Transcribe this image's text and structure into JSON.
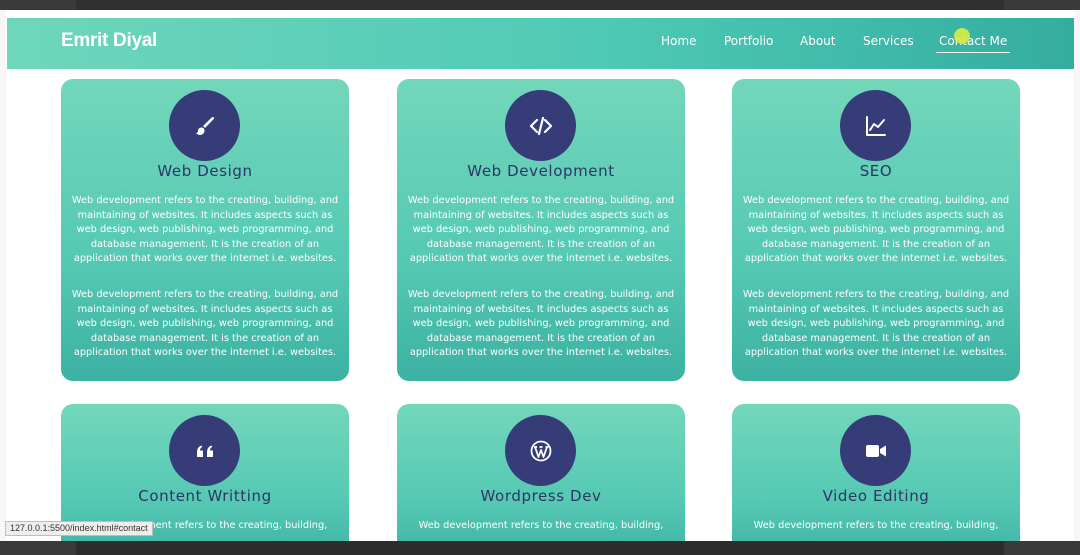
{
  "nav": {
    "brand": "Emrit Diyal",
    "links": [
      "Home",
      "Portfolio",
      "About",
      "Services",
      "Contact Me"
    ]
  },
  "cards": [
    {
      "title": "Web Design",
      "icon": "paintbrush-icon",
      "paragraphs": [
        "Web development refers to the creating, building, and maintaining of websites. It includes aspects such as web design, web publishing, web programming, and database management. It is the creation of an application that works over the internet i.e. websites.",
        "Web development refers to the creating, building, and maintaining of websites. It includes aspects such as web design, web publishing, web programming, and database management. It is the creation of an application that works over the internet i.e. websites."
      ]
    },
    {
      "title": "Web Development",
      "icon": "code-icon",
      "paragraphs": [
        "Web development refers to the creating, building, and maintaining of websites. It includes aspects such as web design, web publishing, web programming, and database management. It is the creation of an application that works over the internet i.e. websites.",
        "Web development refers to the creating, building, and maintaining of websites. It includes aspects such as web design, web publishing, web programming, and database management. It is the creation of an application that works over the internet i.e. websites."
      ]
    },
    {
      "title": "SEO",
      "icon": "line-chart-icon",
      "paragraphs": [
        "Web development refers to the creating, building, and maintaining of websites. It includes aspects such as web design, web publishing, web programming, and database management. It is the creation of an application that works over the internet i.e. websites.",
        "Web development refers to the creating, building, and maintaining of websites. It includes aspects such as web design, web publishing, web programming, and database management. It is the creation of an application that works over the internet i.e. websites."
      ]
    },
    {
      "title": "Content Writting",
      "icon": "quote-icon",
      "paragraphs": [
        "Web development refers to the creating, building,"
      ]
    },
    {
      "title": "Wordpress Dev",
      "icon": "wordpress-icon",
      "paragraphs": [
        "Web development refers to the creating, building,"
      ]
    },
    {
      "title": "Video Editing",
      "icon": "video-camera-icon",
      "paragraphs": [
        "Web development refers to the creating, building,"
      ]
    }
  ],
  "status_bar": {
    "url": "127.0.0.1:5500/index.html#contact"
  },
  "colors": {
    "accent_dark": "#353c77",
    "card_gradient_top": "#73d7bb",
    "card_gradient_bottom": "#3db1a2",
    "navbar_gradient_left": "#6fd6bb",
    "navbar_gradient_right": "#34ada0"
  }
}
